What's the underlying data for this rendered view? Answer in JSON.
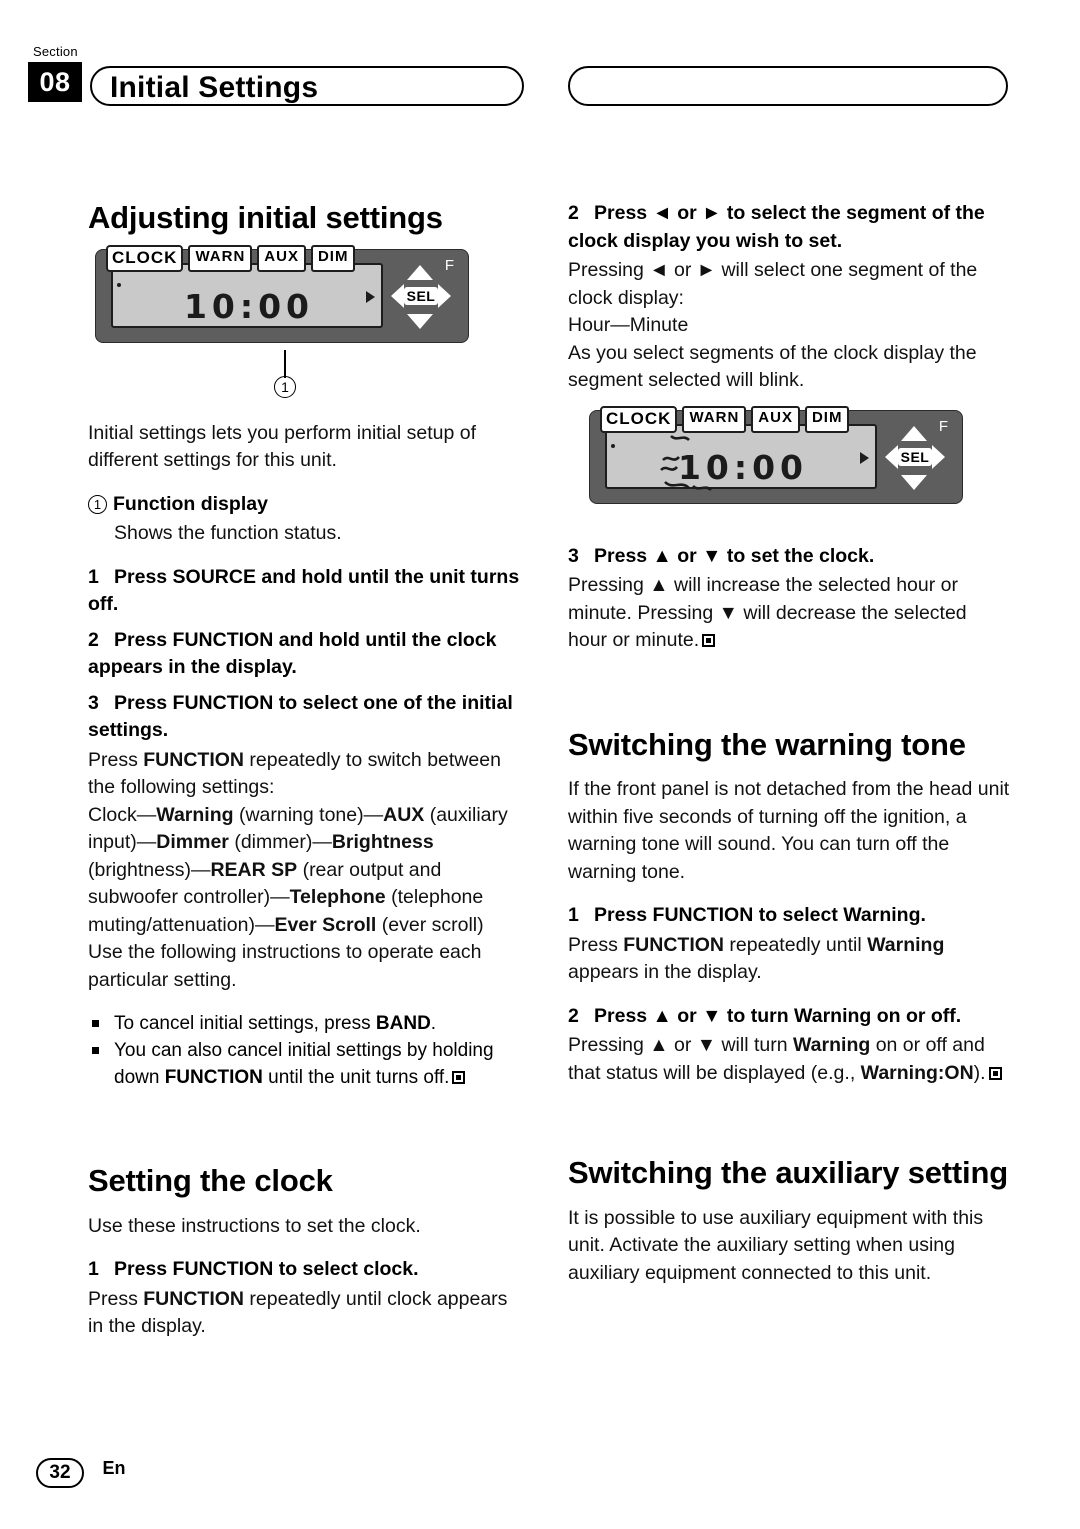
{
  "header": {
    "section_label": "Section",
    "section_number": "08",
    "title": "Initial Settings"
  },
  "footer": {
    "page_number": "32",
    "language": "En"
  },
  "left_column": {
    "heading": "Adjusting initial settings",
    "unit_display": {
      "tag_clock": "CLOCK",
      "tag_warn": "WARN",
      "tag_aux": "AUX",
      "tag_dim": "DIM",
      "time": "10:00",
      "pad_f": "F",
      "pad_sel": "SEL",
      "callout": "1"
    },
    "intro": "Initial settings lets you perform initial setup of different settings for this unit.",
    "function_display_title": "Function display",
    "function_display_num": "1",
    "function_display_text": "Shows the function status.",
    "step1": {
      "num": "1",
      "text": "Press SOURCE and hold until the unit turns off."
    },
    "step2": {
      "num": "2",
      "text": "Press FUNCTION and hold until the clock appears in the display."
    },
    "step3": {
      "num": "3",
      "text": "Press FUNCTION to select one of the initial settings."
    },
    "step3_body_1": "Press ",
    "step3_body_1b": "FUNCTION",
    "step3_body_1c": " repeatedly to switch between the following settings:",
    "settings_chain": [
      {
        "text": "Clock—",
        "bold": false
      },
      {
        "text": "Warning",
        "bold": true
      },
      {
        "text": " (warning tone)—",
        "bold": false
      },
      {
        "text": "AUX",
        "bold": true
      },
      {
        "text": " (auxiliary input)—",
        "bold": false
      },
      {
        "text": "Dimmer",
        "bold": true
      },
      {
        "text": " (dimmer)—",
        "bold": false
      },
      {
        "text": "Brightness",
        "bold": true
      },
      {
        "text": " (brightness)—",
        "bold": false
      },
      {
        "text": "REAR SP",
        "bold": true
      },
      {
        "text": " (rear output and subwoofer controller)—",
        "bold": false
      },
      {
        "text": "Telephone",
        "bold": true
      },
      {
        "text": " (telephone muting/attenuation)—",
        "bold": false
      },
      {
        "text": "Ever Scroll",
        "bold": true
      },
      {
        "text": " (ever scroll)",
        "bold": false
      }
    ],
    "step3_body_2": "Use the following instructions to operate each particular setting.",
    "bullet1_a": "To cancel initial settings, press ",
    "bullet1_b": "BAND",
    "bullet1_c": ".",
    "bullet2_a": "You can also cancel initial settings by holding down ",
    "bullet2_b": "FUNCTION",
    "bullet2_c": " until the unit turns off.",
    "clock_heading": "Setting the clock",
    "clock_intro": "Use these instructions to set the clock.",
    "clock_step1": {
      "num": "1",
      "text": "Press FUNCTION to select clock."
    },
    "clock_step1_body_a": "Press ",
    "clock_step1_body_b": "FUNCTION",
    "clock_step1_body_c": " repeatedly until clock appears in the display."
  },
  "right_column": {
    "step2": {
      "num": "2",
      "text": "Press ◄ or ► to select the segment of the clock display you wish to set."
    },
    "step2_body_a": "Pressing ◄ or ► will select one segment of the clock display:",
    "step2_body_b": "Hour—Minute",
    "step2_body_c": "As you select segments of the clock display the segment selected will blink.",
    "unit_display": {
      "tag_clock": "CLOCK",
      "tag_warn": "WARN",
      "tag_aux": "AUX",
      "tag_dim": "DIM",
      "time": "10:00",
      "pad_f": "F",
      "pad_sel": "SEL"
    },
    "step3": {
      "num": "3",
      "text": "Press ▲ or ▼ to set the clock."
    },
    "step3_body": "Pressing ▲ will increase the selected hour or minute. Pressing ▼ will decrease the selected hour or minute.",
    "warn_heading": "Switching the warning tone",
    "warn_body": "If the front panel is not detached from the head unit within five seconds of turning off the ignition, a warning tone will sound. You can turn off the warning tone.",
    "warn_step1": {
      "num": "1",
      "text": "Press FUNCTION to select Warning."
    },
    "warn_step1_body_a": "Press ",
    "warn_step1_body_b": "FUNCTION",
    "warn_step1_body_c": " repeatedly until ",
    "warn_step1_body_d": "Warning",
    "warn_step1_body_e": " appears in the display.",
    "warn_step2": {
      "num": "2",
      "text": "Press ▲ or ▼ to turn Warning on or off."
    },
    "warn_step2_body_a": "Pressing ▲ or ▼ will turn ",
    "warn_step2_body_b": "Warning",
    "warn_step2_body_c": " on or off and that status will be displayed (e.g., ",
    "warn_step2_body_d": "Warning:ON",
    "warn_step2_body_e": ").",
    "aux_heading": "Switching the auxiliary setting",
    "aux_body": "It is possible to use auxiliary equipment with this unit. Activate the auxiliary setting when using auxiliary equipment connected to this unit."
  }
}
